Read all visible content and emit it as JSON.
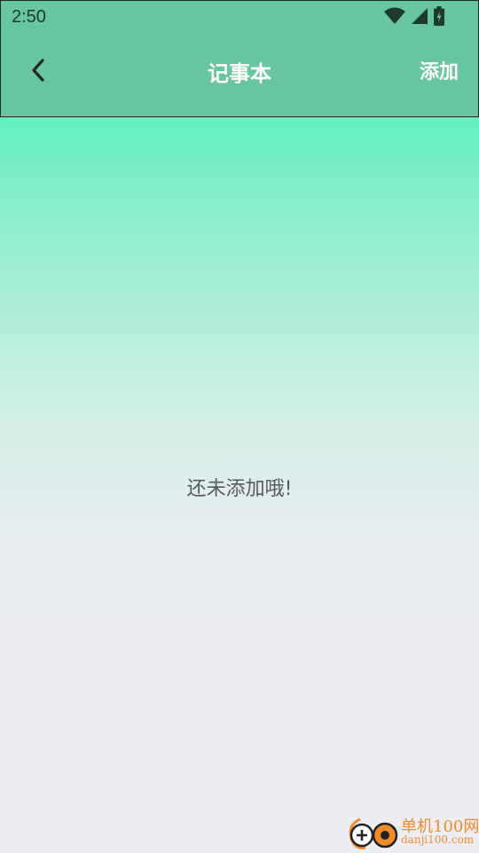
{
  "status_bar": {
    "time": "2:50",
    "icons": [
      "wifi-icon",
      "signal-icon",
      "battery-charging-icon"
    ]
  },
  "toolbar": {
    "back_icon": "chevron-left-icon",
    "title": "记事本",
    "add_label": "添加"
  },
  "main": {
    "empty_message": "还未添加哦!"
  },
  "watermark": {
    "line1": "单机100网",
    "line2": "danji100.com"
  },
  "colors": {
    "header_bg": "#67c59f",
    "gradient_top": "#62f0bf",
    "page_bg": "#eceef3",
    "toolbar_text": "#ffffff",
    "message_text": "#555a5f",
    "watermark": "#f08a2a"
  }
}
